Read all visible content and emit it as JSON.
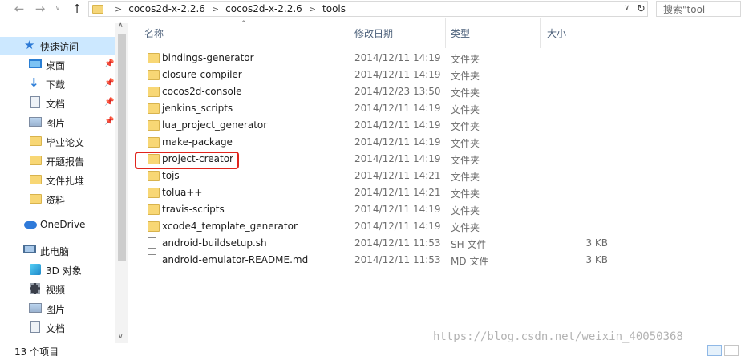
{
  "address": {
    "back_icon": "back-arrow-icon",
    "forward_icon": "forward-arrow-icon",
    "up_icon": "up-arrow-icon",
    "crumbs": [
      "cocos2d-x-2.2.6",
      "cocos2d-x-2.2.6",
      "tools"
    ],
    "search_placeholder": "搜索\"tool"
  },
  "sidebar": {
    "quick_access": "快速访问",
    "items": [
      {
        "label": "桌面",
        "icon": "desktop-icon",
        "pinned": true
      },
      {
        "label": "下载",
        "icon": "download-icon",
        "pinned": true
      },
      {
        "label": "文档",
        "icon": "document-icon",
        "pinned": true
      },
      {
        "label": "图片",
        "icon": "picture-icon",
        "pinned": true
      },
      {
        "label": "毕业论文",
        "icon": "folder-icon",
        "pinned": false
      },
      {
        "label": "开题报告",
        "icon": "folder-icon",
        "pinned": false
      },
      {
        "label": "文件扎堆",
        "icon": "folder-icon",
        "pinned": false
      },
      {
        "label": "资料",
        "icon": "folder-icon",
        "pinned": false
      }
    ],
    "onedrive": "OneDrive",
    "this_pc": "此电脑",
    "pc_items": [
      {
        "label": "3D 对象",
        "icon": "3d-objects-icon"
      },
      {
        "label": "视频",
        "icon": "video-icon"
      },
      {
        "label": "图片",
        "icon": "picture-icon"
      },
      {
        "label": "文档",
        "icon": "document-icon"
      }
    ]
  },
  "columns": {
    "name": "名称",
    "date": "修改日期",
    "type": "类型",
    "size": "大小"
  },
  "files": [
    {
      "name": "bindings-generator",
      "date": "2014/12/11 14:19",
      "type": "文件夹",
      "size": "",
      "kind": "folder"
    },
    {
      "name": "closure-compiler",
      "date": "2014/12/11 14:19",
      "type": "文件夹",
      "size": "",
      "kind": "folder"
    },
    {
      "name": "cocos2d-console",
      "date": "2014/12/23 13:50",
      "type": "文件夹",
      "size": "",
      "kind": "folder"
    },
    {
      "name": "jenkins_scripts",
      "date": "2014/12/11 14:19",
      "type": "文件夹",
      "size": "",
      "kind": "folder"
    },
    {
      "name": "lua_project_generator",
      "date": "2014/12/11 14:19",
      "type": "文件夹",
      "size": "",
      "kind": "folder"
    },
    {
      "name": "make-package",
      "date": "2014/12/11 14:19",
      "type": "文件夹",
      "size": "",
      "kind": "folder"
    },
    {
      "name": "project-creator",
      "date": "2014/12/11 14:19",
      "type": "文件夹",
      "size": "",
      "kind": "folder"
    },
    {
      "name": "tojs",
      "date": "2014/12/11 14:21",
      "type": "文件夹",
      "size": "",
      "kind": "folder"
    },
    {
      "name": "tolua++",
      "date": "2014/12/11 14:21",
      "type": "文件夹",
      "size": "",
      "kind": "folder"
    },
    {
      "name": "travis-scripts",
      "date": "2014/12/11 14:19",
      "type": "文件夹",
      "size": "",
      "kind": "folder"
    },
    {
      "name": "xcode4_template_generator",
      "date": "2014/12/11 14:19",
      "type": "文件夹",
      "size": "",
      "kind": "folder"
    },
    {
      "name": "android-buildsetup.sh",
      "date": "2014/12/11 11:53",
      "type": "SH 文件",
      "size": "3 KB",
      "kind": "file"
    },
    {
      "name": "android-emulator-README.md",
      "date": "2014/12/11 11:53",
      "type": "MD 文件",
      "size": "3 KB",
      "kind": "file"
    }
  ],
  "highlight_color": "#e0241c",
  "status": {
    "count": "13 个项目"
  },
  "watermark": "https://blog.csdn.net/weixin_40050368"
}
